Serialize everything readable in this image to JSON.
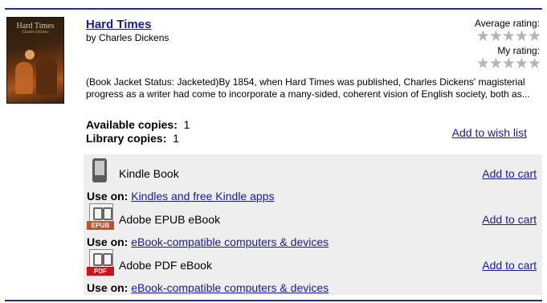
{
  "book": {
    "cover_title": "Hard Times",
    "cover_author": "Charles Dickens",
    "title": "Hard Times",
    "author": "by Charles Dickens",
    "description": "(Book Jacket Status: Jacketed)By 1854, when Hard Times was published, Charles Dickens' magisterial progress as a writer had come to incorporate a many-sided, coherent vision of English society, both as..."
  },
  "ratings": {
    "average_label": "Average rating:",
    "my_label": "My rating:",
    "average_value": 0,
    "my_value": 0,
    "star_color": "#b5b5b5"
  },
  "copies": {
    "available_label": "Available copies:",
    "available_value": "1",
    "library_label": "Library copies:",
    "library_value": "1"
  },
  "wish_list_label": "Add to wish list",
  "formats": [
    {
      "name": "Kindle Book",
      "icon": "kindle-icon",
      "cart": "Add to cart",
      "use_label": "Use on:",
      "use_link": "Kindles and free Kindle apps"
    },
    {
      "name": "Adobe EPUB eBook",
      "icon": "epub-icon",
      "icon_text": "EPUB",
      "cart": "Add to cart",
      "use_label": "Use on:",
      "use_link": "eBook-compatible computers & devices"
    },
    {
      "name": "Adobe PDF eBook",
      "icon": "pdf-icon",
      "icon_text": "PDF",
      "cart": "Add to cart",
      "use_label": "Use on:",
      "use_link": "eBook-compatible computers & devices"
    }
  ],
  "colors": {
    "link": "#1a1a99",
    "rule": "#1f2f86",
    "format_bg": "#eeeeee"
  }
}
